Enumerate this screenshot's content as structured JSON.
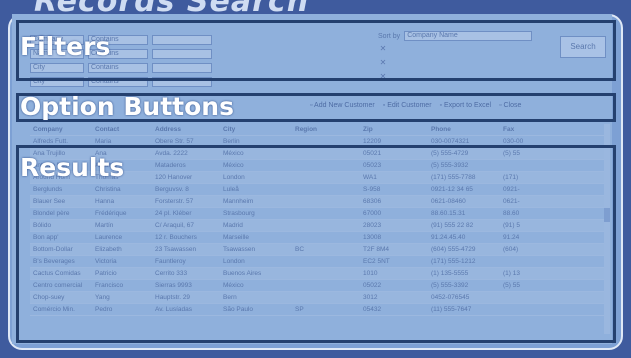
{
  "title": "Records Search",
  "sections": {
    "filters": "Filters",
    "options": "Option Buttons",
    "results": "Results"
  },
  "filters": {
    "rows": [
      {
        "field": "Company",
        "op": "Contains",
        "value": ""
      },
      {
        "field": "Name",
        "op": "Contains",
        "value": ""
      },
      {
        "field": "City",
        "op": "Contains",
        "value": ""
      },
      {
        "field": "City",
        "op": "Contains",
        "value": ""
      }
    ],
    "sort_label": "Sort by",
    "sort_value": "Company Name",
    "search_label": "Search"
  },
  "options": {
    "add_new": "Add New Customer",
    "edit": "Edit Customer",
    "export": "Export to Excel",
    "close": "Close"
  },
  "results": {
    "headers": [
      "Company",
      "Contact",
      "Address",
      "City",
      "Region",
      "Zip",
      "Phone",
      "Fax"
    ],
    "rows": [
      [
        "Alfreds Futt.",
        "Maria",
        "Obere Str. 57",
        "Berlin",
        "",
        "12209",
        "030-0074321",
        "030-00"
      ],
      [
        "Ana Trujillo",
        "Ana",
        "Avda. 2222",
        "México",
        "",
        "05021",
        "(5) 555-4729",
        "(5) 55"
      ],
      [
        "Antonio Mor.",
        "Antonio",
        "Mataderos",
        "México",
        "",
        "05023",
        "(5) 555-3932",
        ""
      ],
      [
        "Around Horn",
        "Thomas",
        "120 Hanover",
        "London",
        "",
        "WA1",
        "(171) 555-7788",
        "(171)"
      ],
      [
        "Berglunds",
        "Christina",
        "Berguvsv. 8",
        "Luleå",
        "",
        "S-958",
        "0921-12 34 65",
        "0921-"
      ],
      [
        "Blauer See",
        "Hanna",
        "Forsterstr. 57",
        "Mannheim",
        "",
        "68306",
        "0621-08460",
        "0621-"
      ],
      [
        "Blondel père",
        "Frédérique",
        "24 pl. Kléber",
        "Strasbourg",
        "",
        "67000",
        "88.60.15.31",
        "88.60"
      ],
      [
        "Bólido",
        "Martín",
        "C/ Araquil, 67",
        "Madrid",
        "",
        "28023",
        "(91) 555 22 82",
        "(91) 5"
      ],
      [
        "Bon app'",
        "Laurence",
        "12 r. Bouchers",
        "Marseille",
        "",
        "13008",
        "91.24.45.40",
        "91.24"
      ],
      [
        "Bottom-Dollar",
        "Elizabeth",
        "23 Tsawassen",
        "Tsawassen",
        "BC",
        "T2F 8M4",
        "(604) 555-4729",
        "(604)"
      ],
      [
        "B's Beverages",
        "Victoria",
        "Fauntleroy",
        "London",
        "",
        "EC2 5NT",
        "(171) 555-1212",
        ""
      ],
      [
        "Cactus Comidas",
        "Patricio",
        "Cerrito 333",
        "Buenos Aires",
        "",
        "1010",
        "(1) 135-5555",
        "(1) 13"
      ],
      [
        "Centro comercial",
        "Francisco",
        "Sierras 9993",
        "México",
        "",
        "05022",
        "(5) 555-3392",
        "(5) 55"
      ],
      [
        "Chop-suey",
        "Yang",
        "Hauptstr. 29",
        "Bern",
        "",
        "3012",
        "0452-076545",
        ""
      ],
      [
        "Comércio Min.",
        "Pedro",
        "Av. Lusíadas",
        "São Paulo",
        "SP",
        "05432",
        "(11) 555-7647",
        ""
      ]
    ]
  }
}
